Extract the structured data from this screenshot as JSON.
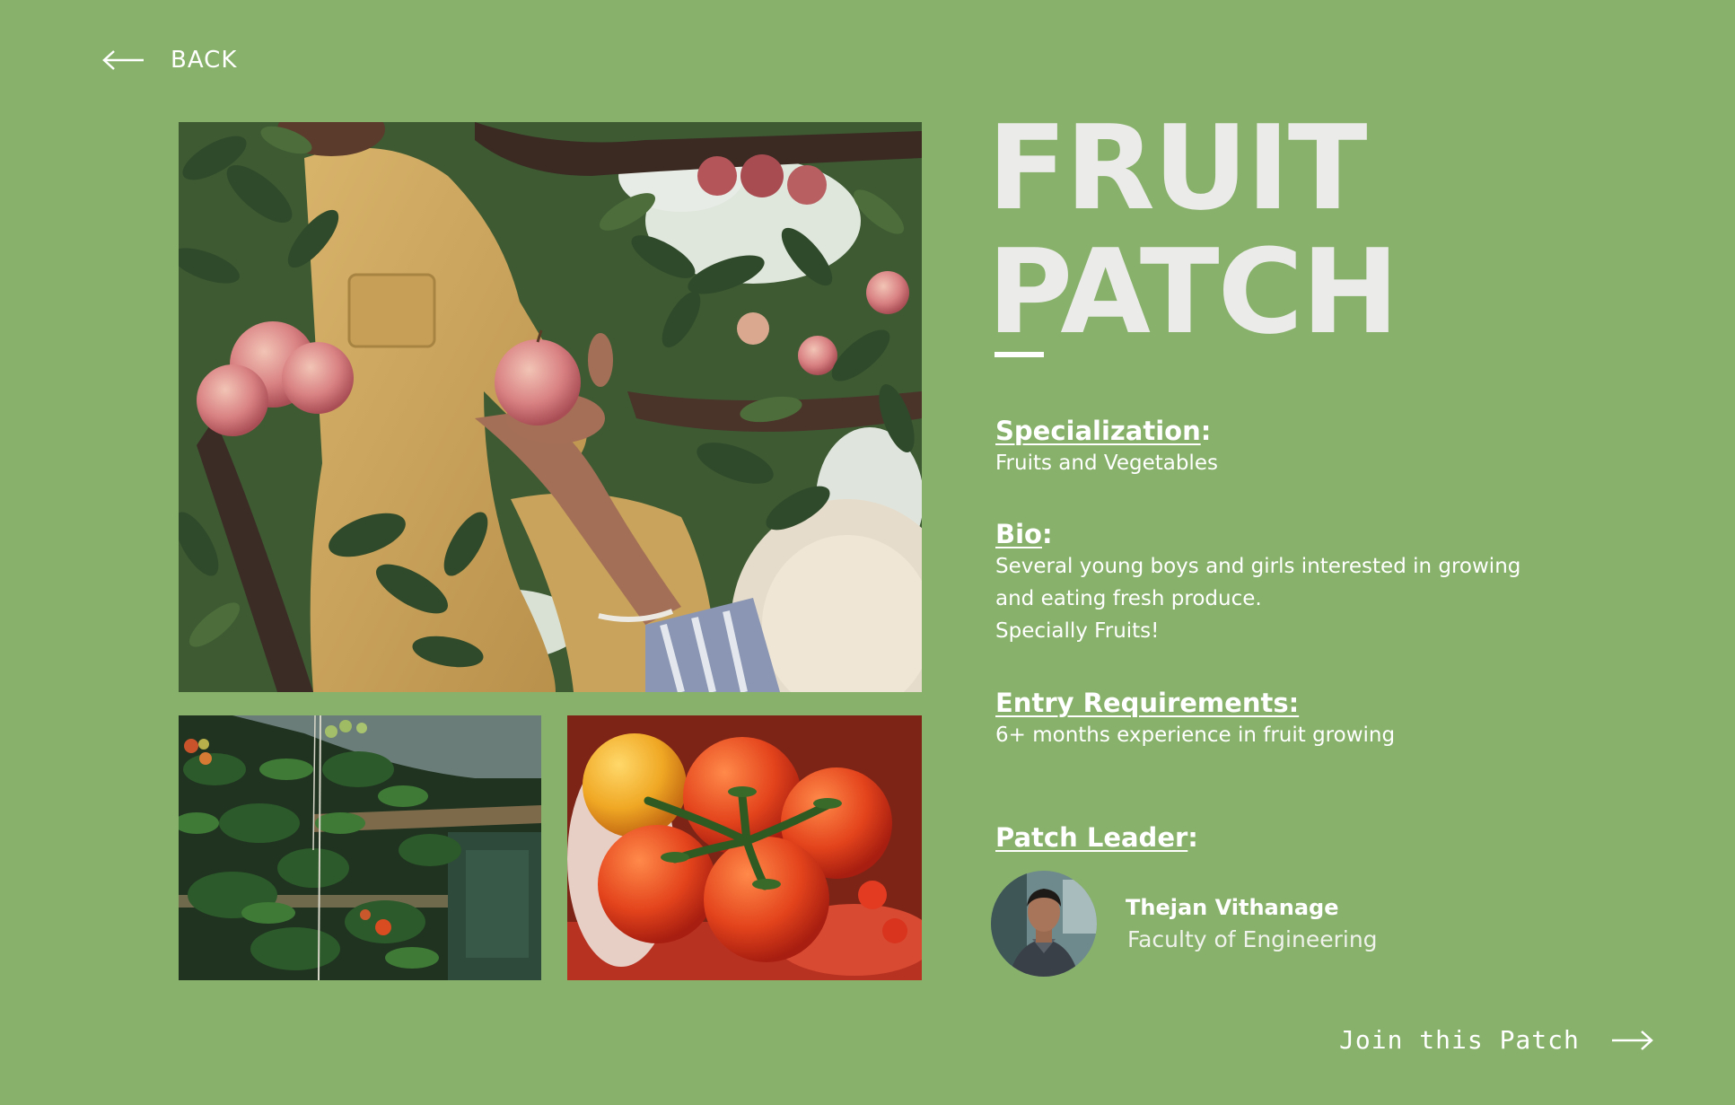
{
  "colors": {
    "background": "#88b26b",
    "title": "#ebebea",
    "text": "#ffffff"
  },
  "nav": {
    "back_label": "BACK",
    "back_icon": "arrow-left-icon"
  },
  "title": {
    "line1": "FRUIT",
    "line2": "PATCH"
  },
  "specialization": {
    "label": "Specialization",
    "suffix": ":",
    "value": "Fruits and Vegetables"
  },
  "bio": {
    "label": "Bio",
    "suffix": ":",
    "lines": [
      "Several young boys and girls interested in growing",
      "and eating fresh produce.",
      "Specially Fruits!"
    ]
  },
  "entry": {
    "label": "Entry Requirements:",
    "value": "6+ months experience in fruit growing"
  },
  "leader": {
    "label": "Patch Leader",
    "suffix": ":",
    "name": "Thejan Vithanage",
    "faculty": "Faculty of Engineering"
  },
  "join": {
    "label": "Join this Patch",
    "icon": "arrow-right-icon"
  },
  "photos": {
    "main": "apple-picking-photo",
    "left": "greenhouse-tomato-plants-photo",
    "right": "tomatoes-on-vine-photo"
  }
}
